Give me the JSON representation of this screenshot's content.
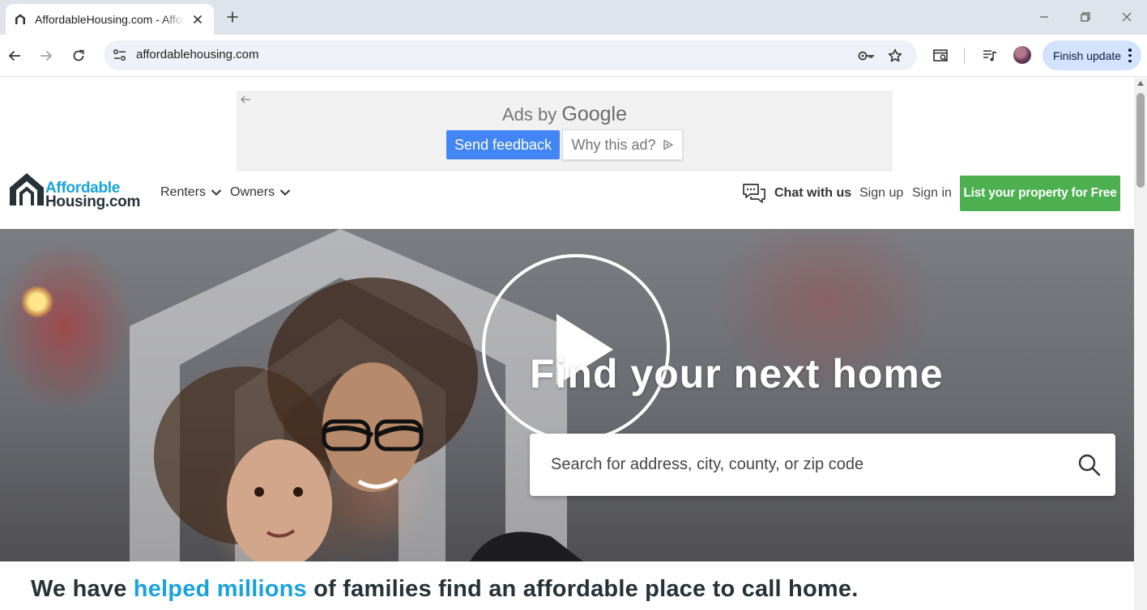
{
  "browser": {
    "tab_title": "AffordableHousing.com - Affordable Housing",
    "url": "affordablehousing.com",
    "finish_update_label": "Finish update"
  },
  "ad": {
    "ads_by": "Ads by",
    "google": "Google",
    "send_feedback": "Send feedback",
    "why_this_ad": "Why this ad?"
  },
  "header": {
    "logo_line1": "Affordable",
    "logo_line2": "Housing.com",
    "nav": [
      {
        "label": "Renters"
      },
      {
        "label": "Owners"
      }
    ],
    "chat_label": "Chat with us",
    "sign_up": "Sign up",
    "sign_in": "Sign in",
    "list_property": "List your property for Free"
  },
  "hero": {
    "headline": "Find your next home",
    "search_placeholder": "Search for address, city, county, or zip code"
  },
  "tagline": {
    "prefix": "We have ",
    "highlight": "helped millions",
    "suffix": " of families find an affordable place to call home."
  },
  "colors": {
    "brand_blue": "#1aa3d9",
    "brand_dark": "#263238",
    "cta_green": "#4caf50",
    "ad_button_blue": "#4285f4"
  }
}
